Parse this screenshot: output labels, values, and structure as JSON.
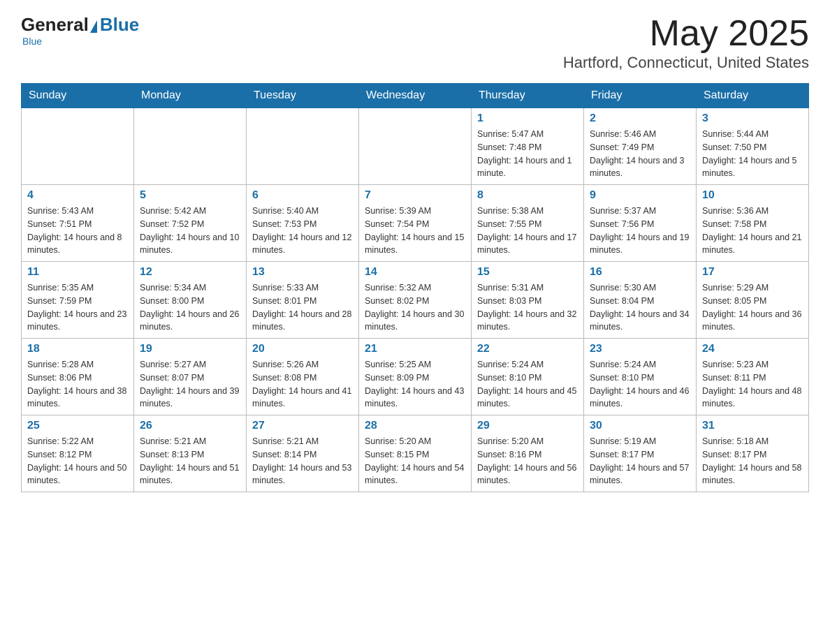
{
  "logo": {
    "general": "General",
    "blue": "Blue",
    "tagline": "Blue"
  },
  "header": {
    "title": "May 2025",
    "subtitle": "Hartford, Connecticut, United States"
  },
  "weekdays": [
    "Sunday",
    "Monday",
    "Tuesday",
    "Wednesday",
    "Thursday",
    "Friday",
    "Saturday"
  ],
  "weeks": [
    [
      {
        "day": "",
        "info": ""
      },
      {
        "day": "",
        "info": ""
      },
      {
        "day": "",
        "info": ""
      },
      {
        "day": "",
        "info": ""
      },
      {
        "day": "1",
        "info": "Sunrise: 5:47 AM\nSunset: 7:48 PM\nDaylight: 14 hours and 1 minute."
      },
      {
        "day": "2",
        "info": "Sunrise: 5:46 AM\nSunset: 7:49 PM\nDaylight: 14 hours and 3 minutes."
      },
      {
        "day": "3",
        "info": "Sunrise: 5:44 AM\nSunset: 7:50 PM\nDaylight: 14 hours and 5 minutes."
      }
    ],
    [
      {
        "day": "4",
        "info": "Sunrise: 5:43 AM\nSunset: 7:51 PM\nDaylight: 14 hours and 8 minutes."
      },
      {
        "day": "5",
        "info": "Sunrise: 5:42 AM\nSunset: 7:52 PM\nDaylight: 14 hours and 10 minutes."
      },
      {
        "day": "6",
        "info": "Sunrise: 5:40 AM\nSunset: 7:53 PM\nDaylight: 14 hours and 12 minutes."
      },
      {
        "day": "7",
        "info": "Sunrise: 5:39 AM\nSunset: 7:54 PM\nDaylight: 14 hours and 15 minutes."
      },
      {
        "day": "8",
        "info": "Sunrise: 5:38 AM\nSunset: 7:55 PM\nDaylight: 14 hours and 17 minutes."
      },
      {
        "day": "9",
        "info": "Sunrise: 5:37 AM\nSunset: 7:56 PM\nDaylight: 14 hours and 19 minutes."
      },
      {
        "day": "10",
        "info": "Sunrise: 5:36 AM\nSunset: 7:58 PM\nDaylight: 14 hours and 21 minutes."
      }
    ],
    [
      {
        "day": "11",
        "info": "Sunrise: 5:35 AM\nSunset: 7:59 PM\nDaylight: 14 hours and 23 minutes."
      },
      {
        "day": "12",
        "info": "Sunrise: 5:34 AM\nSunset: 8:00 PM\nDaylight: 14 hours and 26 minutes."
      },
      {
        "day": "13",
        "info": "Sunrise: 5:33 AM\nSunset: 8:01 PM\nDaylight: 14 hours and 28 minutes."
      },
      {
        "day": "14",
        "info": "Sunrise: 5:32 AM\nSunset: 8:02 PM\nDaylight: 14 hours and 30 minutes."
      },
      {
        "day": "15",
        "info": "Sunrise: 5:31 AM\nSunset: 8:03 PM\nDaylight: 14 hours and 32 minutes."
      },
      {
        "day": "16",
        "info": "Sunrise: 5:30 AM\nSunset: 8:04 PM\nDaylight: 14 hours and 34 minutes."
      },
      {
        "day": "17",
        "info": "Sunrise: 5:29 AM\nSunset: 8:05 PM\nDaylight: 14 hours and 36 minutes."
      }
    ],
    [
      {
        "day": "18",
        "info": "Sunrise: 5:28 AM\nSunset: 8:06 PM\nDaylight: 14 hours and 38 minutes."
      },
      {
        "day": "19",
        "info": "Sunrise: 5:27 AM\nSunset: 8:07 PM\nDaylight: 14 hours and 39 minutes."
      },
      {
        "day": "20",
        "info": "Sunrise: 5:26 AM\nSunset: 8:08 PM\nDaylight: 14 hours and 41 minutes."
      },
      {
        "day": "21",
        "info": "Sunrise: 5:25 AM\nSunset: 8:09 PM\nDaylight: 14 hours and 43 minutes."
      },
      {
        "day": "22",
        "info": "Sunrise: 5:24 AM\nSunset: 8:10 PM\nDaylight: 14 hours and 45 minutes."
      },
      {
        "day": "23",
        "info": "Sunrise: 5:24 AM\nSunset: 8:10 PM\nDaylight: 14 hours and 46 minutes."
      },
      {
        "day": "24",
        "info": "Sunrise: 5:23 AM\nSunset: 8:11 PM\nDaylight: 14 hours and 48 minutes."
      }
    ],
    [
      {
        "day": "25",
        "info": "Sunrise: 5:22 AM\nSunset: 8:12 PM\nDaylight: 14 hours and 50 minutes."
      },
      {
        "day": "26",
        "info": "Sunrise: 5:21 AM\nSunset: 8:13 PM\nDaylight: 14 hours and 51 minutes."
      },
      {
        "day": "27",
        "info": "Sunrise: 5:21 AM\nSunset: 8:14 PM\nDaylight: 14 hours and 53 minutes."
      },
      {
        "day": "28",
        "info": "Sunrise: 5:20 AM\nSunset: 8:15 PM\nDaylight: 14 hours and 54 minutes."
      },
      {
        "day": "29",
        "info": "Sunrise: 5:20 AM\nSunset: 8:16 PM\nDaylight: 14 hours and 56 minutes."
      },
      {
        "day": "30",
        "info": "Sunrise: 5:19 AM\nSunset: 8:17 PM\nDaylight: 14 hours and 57 minutes."
      },
      {
        "day": "31",
        "info": "Sunrise: 5:18 AM\nSunset: 8:17 PM\nDaylight: 14 hours and 58 minutes."
      }
    ]
  ]
}
